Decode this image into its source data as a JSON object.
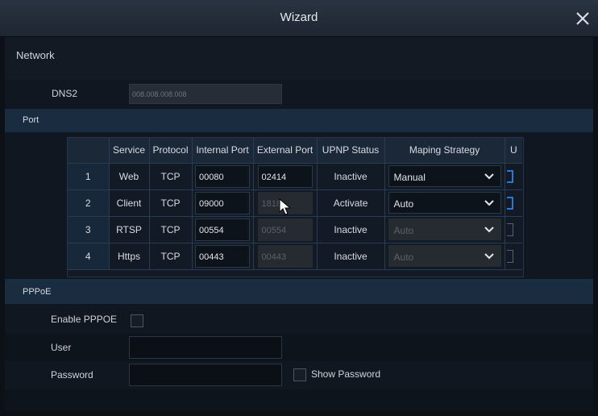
{
  "window": {
    "title": "Wizard"
  },
  "network": {
    "label": "Network"
  },
  "dns2": {
    "label": "DNS2",
    "value": "008.008.008.008"
  },
  "port": {
    "section_label": "Port",
    "columns": [
      "",
      "Service",
      "Protocol",
      "Internal Port",
      "External Port",
      "UPNP Status",
      "Maping Strategy",
      "U"
    ],
    "rows": [
      {
        "idx": "1",
        "service": "Web",
        "protocol": "TCP",
        "internal": "00080",
        "external": "02414",
        "status": "Inactive",
        "strategy": "Manual"
      },
      {
        "idx": "2",
        "service": "Client",
        "protocol": "TCP",
        "internal": "09000",
        "external": "1818",
        "status": "Activate",
        "strategy": "Auto"
      },
      {
        "idx": "3",
        "service": "RTSP",
        "protocol": "TCP",
        "internal": "00554",
        "external": "00554",
        "status": "Inactive",
        "strategy": "Auto"
      },
      {
        "idx": "4",
        "service": "Https",
        "protocol": "TCP",
        "internal": "00443",
        "external": "00443",
        "status": "Inactive",
        "strategy": "Auto"
      }
    ]
  },
  "pppoe": {
    "section_label": "PPPoE",
    "enable_label": "Enable PPPOE",
    "user_label": "User",
    "user_value": "",
    "password_label": "Password",
    "password_value": "",
    "show_password_label": "Show Password"
  },
  "colors": {
    "accent": "#2b78d4",
    "section_bar": "#1a2c40",
    "background": "#0c1118"
  },
  "icons": {
    "close": "close-icon",
    "dropdown": "chevron-down-icon",
    "cursor": "mouse-pointer-icon"
  }
}
